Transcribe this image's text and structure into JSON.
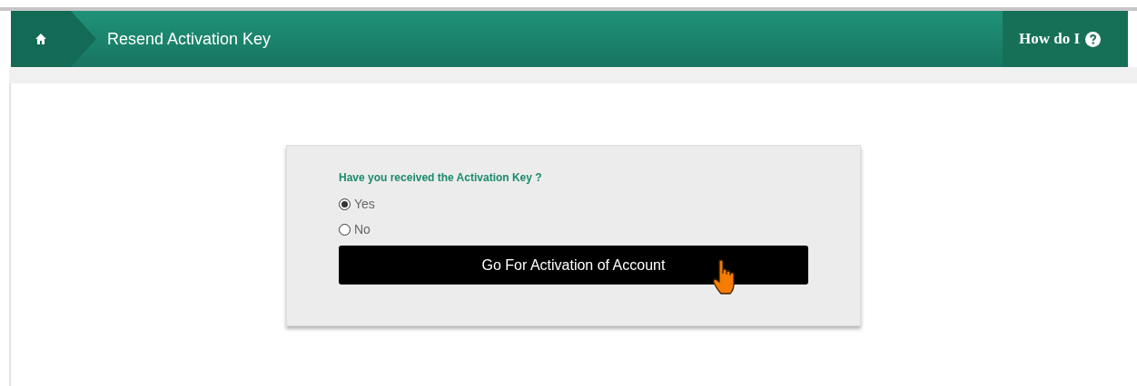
{
  "header": {
    "title": "Resend Activation Key",
    "help_label": "How do I"
  },
  "form": {
    "question": "Have you received the Activation Key ?",
    "options": [
      {
        "label": "Yes",
        "selected": true
      },
      {
        "label": "No",
        "selected": false
      }
    ],
    "button": "Go For Activation of Account"
  }
}
